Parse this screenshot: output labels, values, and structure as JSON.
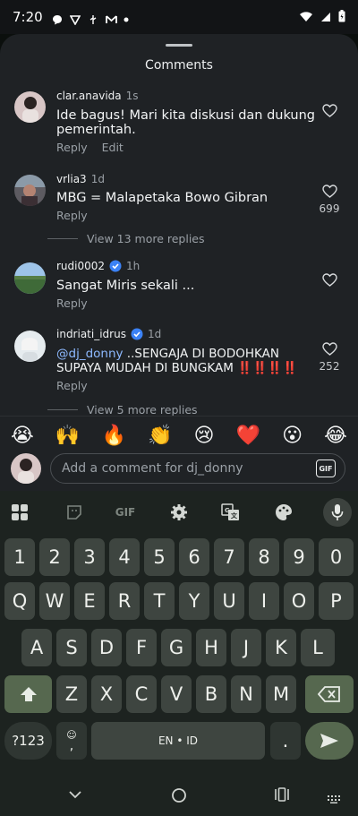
{
  "status_bar": {
    "time": "7:20"
  },
  "sheet": {
    "title": "Comments"
  },
  "comments": [
    {
      "username": "clar.anavida",
      "time": "1s",
      "text": "Ide bagus! Mari kita diskusi dan dukung pemerintah.",
      "reply_label": "Reply",
      "edit_label": "Edit"
    },
    {
      "username": "vrlia3",
      "time": "1d",
      "text": "MBG = Malapetaka Bowo Gibran",
      "reply_label": "Reply",
      "likes": "699",
      "view_more": "View 13 more replies"
    },
    {
      "username": "rudi0002",
      "time": "1h",
      "text": "Sangat Miris sekali ...",
      "reply_label": "Reply"
    },
    {
      "username": "indriati_idrus",
      "time": "1d",
      "mention": "@dj_donny",
      "text": " ..SENGAJA DI BODOHKAN SUPAYA MUDAH DI BUNGKAM ‼️‼️‼️‼️",
      "reply_label": "Reply",
      "likes": "252",
      "view_more": "View 5 more replies"
    }
  ],
  "emoji_bar": [
    "😭",
    "🙌",
    "🔥",
    "👏",
    "😢",
    "❤️",
    "😮",
    "😂"
  ],
  "comment_input": {
    "placeholder": "Add a comment for dj_donny",
    "gif_label": "GIF"
  },
  "keyboard": {
    "toolbar_gif": "GIF",
    "row_numbers": [
      "1",
      "2",
      "3",
      "4",
      "5",
      "6",
      "7",
      "8",
      "9",
      "0"
    ],
    "row_1": [
      "Q",
      "W",
      "E",
      "R",
      "T",
      "Y",
      "U",
      "I",
      "O",
      "P"
    ],
    "row_2": [
      "A",
      "S",
      "D",
      "F",
      "G",
      "H",
      "J",
      "K",
      "L"
    ],
    "row_3": [
      "Z",
      "X",
      "C",
      "V",
      "B",
      "N",
      "M"
    ],
    "symbols_label": "?123",
    "comma_label": ",",
    "space_label": "EN • ID",
    "period_label": "."
  }
}
